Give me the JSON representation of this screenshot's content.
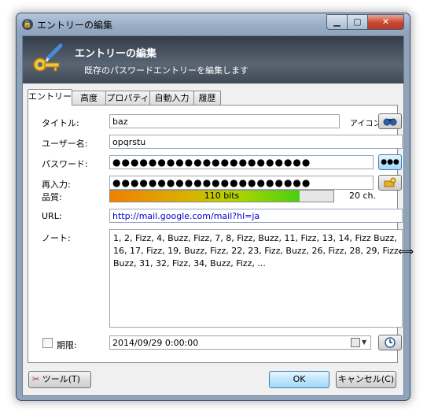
{
  "window": {
    "title": "エントリーの編集"
  },
  "title_controls": {
    "minimize": "▁",
    "maximize": "▢",
    "close": "✕"
  },
  "banner": {
    "title": "エントリーの編集",
    "subtitle": "既存のパスワードエントリーを編集します"
  },
  "tabs": [
    {
      "label": "エントリー",
      "active": true
    },
    {
      "label": "高度"
    },
    {
      "label": "プロパティ"
    },
    {
      "label": "自動入力"
    },
    {
      "label": "履歴"
    }
  ],
  "form": {
    "title_label": "タイトル:",
    "title_value": "baz",
    "icon_label": "アイコン:",
    "username_label": "ユーザー名:",
    "username_value": "opqrstu",
    "password_label": "パスワード:",
    "password_value": "●●●●●●●●●●●●●●●●●●●●●●",
    "show_password_button": "●●●",
    "repeat_label": "再入力:",
    "repeat_value": "●●●●●●●●●●●●●●●●●●●●●●",
    "quality_label": "品質:",
    "quality_text": "110 bits",
    "quality_percent": 85,
    "char_count": "20 ch.",
    "url_label": "URL:",
    "url_value": "http://mail.google.com/mail?hl=ja",
    "notes_label": "ノート:",
    "notes_value": "1, 2, Fizz, 4, Buzz, Fizz, 7, 8, Fizz, Buzz, 11, Fizz, 13, 14, Fizz Buzz, 16, 17, Fizz, 19, Buzz, Fizz, 22, 23, Fizz, Buzz, 26, Fizz, 28, 29, Fizz Buzz, 31, 32, Fizz, 34, Buzz, Fizz, ...",
    "expires_label": "期限:",
    "expires_value": "2014/09/29   0:00:00"
  },
  "buttons": {
    "tools": "ツール(T)",
    "ok": "OK",
    "cancel": "キャンセル(C)"
  },
  "colors": {
    "banner": "#4b5562",
    "link": "#0000cc",
    "ok_border": "#3c7fb1"
  }
}
